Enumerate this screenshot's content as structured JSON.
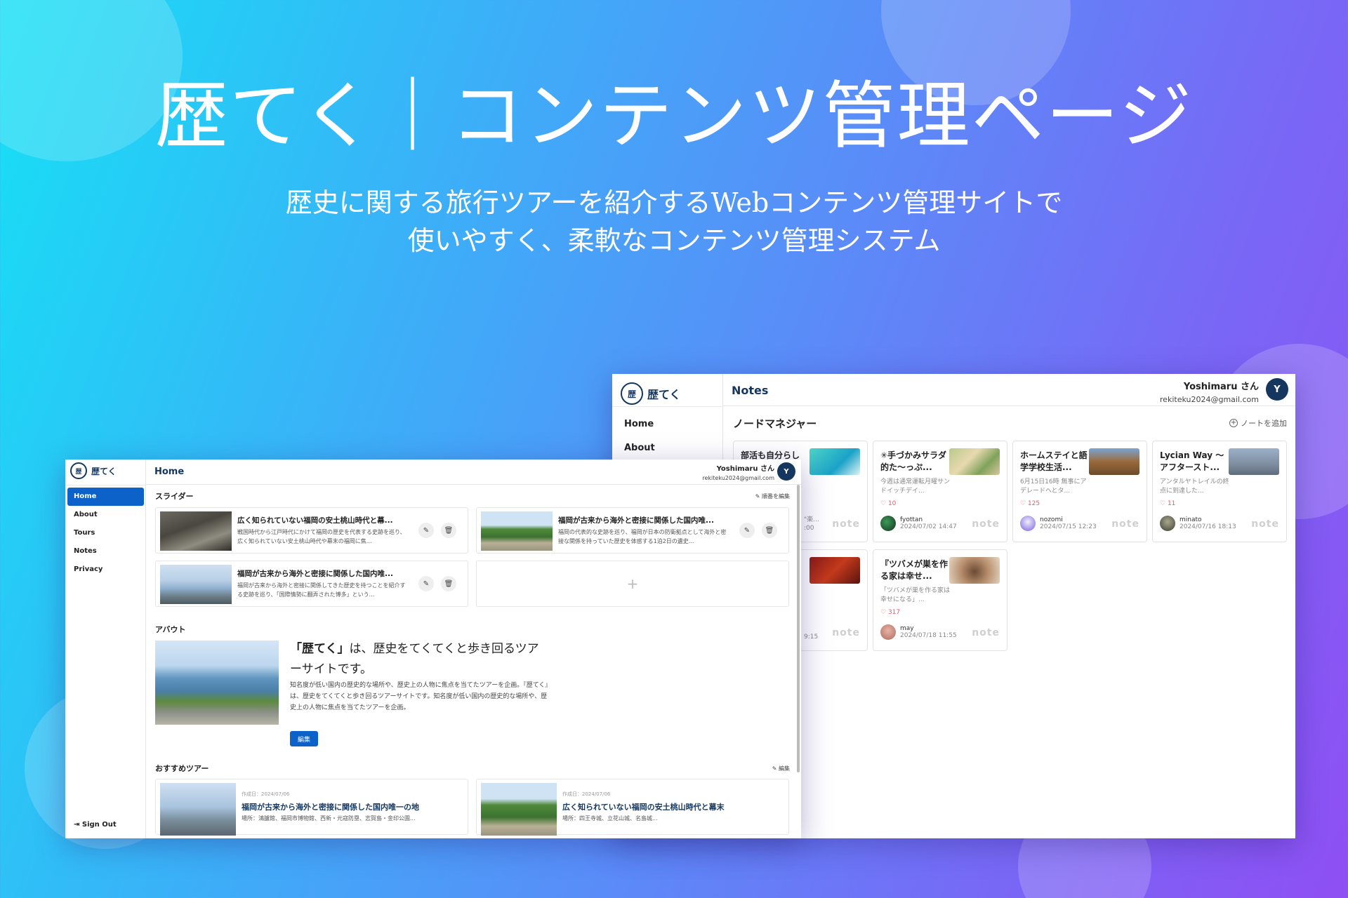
{
  "hero": {
    "title": "歴てく｜コンテンツ管理ページ",
    "subtitle_line1": "歴史に関する旅行ツアーを紹介するWebコンテンツ管理サイトで",
    "subtitle_line2": "使いやすく、柔軟なコンテンツ管理システム"
  },
  "brand": {
    "logo_mark": "歴",
    "name": "歴てく"
  },
  "user": {
    "name": "Yoshimaru さん",
    "email": "rekiteku2024@gmail.com",
    "initial": "Y"
  },
  "notes_window": {
    "page_title": "Notes",
    "nav": [
      "Home",
      "About"
    ],
    "section_title": "ノードマネジャー",
    "add_label": "ノートを追加",
    "brand_mark": "note",
    "cards": [
      {
        "title": "部活も自分らし",
        "excerpt": "",
        "likes": "",
        "author": "",
        "date": "",
        "partial_excerpt": "\"楽...",
        "partial_date": ":00"
      },
      {
        "title": "✳︎手づかみサラダ的た〜っぷ...",
        "excerpt": "今週は通常運転月曜サンドイッチデイ...",
        "likes": "10",
        "author": "fyottan",
        "date": "2024/07/02 14:47"
      },
      {
        "title": "ホームステイと語学学校生活...",
        "excerpt": "6月15日16時 無事にアデレードへとタ...",
        "likes": "125",
        "author": "nozomi",
        "date": "2024/07/15 12:23"
      },
      {
        "title": "Lycian Way 〜アフタースト...",
        "excerpt": "アンタルヤトレイルの終点に到達した...",
        "likes": "11",
        "author": "minato",
        "date": "2024/07/16 18:13"
      },
      {
        "title": "",
        "excerpt": "",
        "likes": "",
        "author": "",
        "date": "",
        "partial_date": "9:15"
      },
      {
        "title": "『ツバメが巣を作る家は幸せ...",
        "excerpt": "「ツバメが巣を作る家は幸せになる」...",
        "likes": "317",
        "author": "may",
        "date": "2024/07/18 11:55"
      }
    ]
  },
  "home_window": {
    "page_title": "Home",
    "nav": [
      "Home",
      "About",
      "Tours",
      "Notes",
      "Privacy"
    ],
    "sign_out": "Sign Out",
    "slider_title": "スライダー",
    "reorder_label": "順番を編集",
    "slides": [
      {
        "title": "広く知られていない福岡の安土桃山時代と幕...",
        "desc": "戦国時代から江戸時代にかけて福岡の歴史を代表する史跡を巡り、広く知られていない安土桃山時代や幕末の福岡に焦..."
      },
      {
        "title": "福岡が古来から海外と密接に関係した国内唯...",
        "desc": "福岡の代表的な史跡を巡り、福岡が日本の防衛拠点として海外と密接な関係を持っていた歴史を体感する1泊2日の遺史..."
      },
      {
        "title": "福岡が古来から海外と密接に関係した国内唯...",
        "desc": "福岡が古来から海外と密接に関係してきた歴史を持つことを紹介する史跡を巡り、「国際情勢に翻弄された博多」という..."
      }
    ],
    "about_title": "アバウト",
    "about_lead_brand": "「歴てく」",
    "about_lead_rest": "は、歴史をてくてくと歩き回るツアーサイトです。",
    "about_body": "知名度が低い国内の歴史的な場所や、歴史上の人物に焦点を当てたツアーを企画。『歴てく』は、歴史をてくてくと歩き回るツアーサイトです。知名度が低い国内の歴史的な場所や、歴史上の人物に焦点を当てたツアーを企画。",
    "edit_button": "編集",
    "tours_title": "おすすめツアー",
    "tours_edit": "編集",
    "tours": [
      {
        "created": "作成日：2024/07/06",
        "title": "福岡が古来から海外と密接に関係した国内唯一の地",
        "place": "場所：鴻臚館、福岡市博物館、西新・元寇防塁、志賀島・金印公園..."
      },
      {
        "created": "作成日：2024/07/06",
        "title": "広く知られていない福岡の安土桃山時代と幕末",
        "place": "場所：四王寺城、立花山城、名島城..."
      }
    ]
  },
  "colors": {
    "accent": "#0d62c9",
    "navy": "#14365f"
  }
}
